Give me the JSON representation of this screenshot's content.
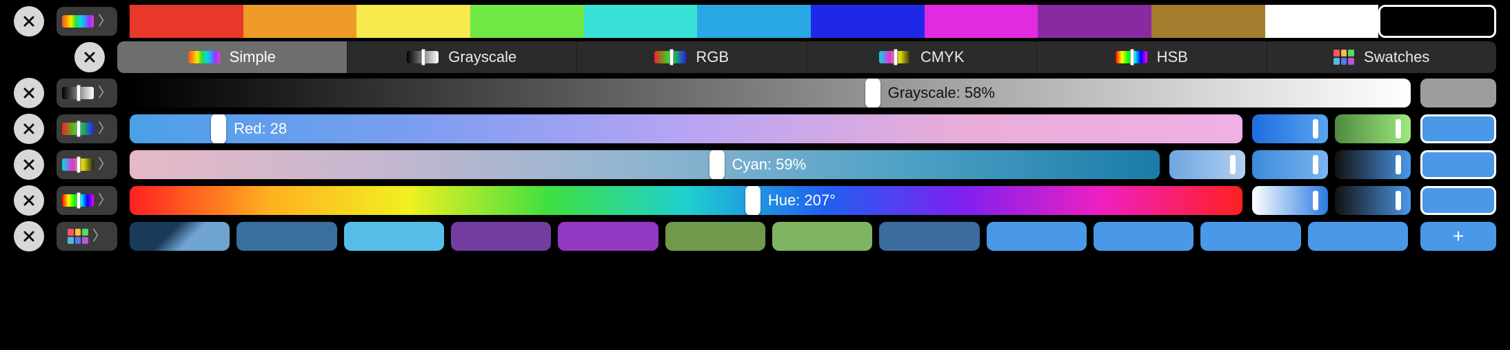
{
  "simple": {
    "colors": [
      "#e8382b",
      "#ef9b27",
      "#f8e94c",
      "#6fe845",
      "#38e2d6",
      "#2aa7e5",
      "#2028e7",
      "#e22be0",
      "#8a2aa0",
      "#a47c2d",
      "#ffffff",
      "#000000"
    ],
    "selected_index": 11
  },
  "tabs": [
    {
      "id": "simple",
      "label": "Simple"
    },
    {
      "id": "grayscale",
      "label": "Grayscale"
    },
    {
      "id": "rgb",
      "label": "RGB"
    },
    {
      "id": "cmyk",
      "label": "CMYK"
    },
    {
      "id": "hsb",
      "label": "HSB"
    },
    {
      "id": "swatches",
      "label": "Swatches"
    }
  ],
  "active_tab": "simple",
  "grayscale": {
    "label": "Grayscale: 58%",
    "percent": 58,
    "preview": "#9d9d9d"
  },
  "rgb": {
    "label": "Red: 28",
    "percent": 8,
    "preview": "#4a98e8",
    "main_gradient": "linear-gradient(90deg,#4aa0e8,#7b9df0,#b7a4f3,#e9add9,#efb0e6)",
    "mini": [
      {
        "g": "linear-gradient(90deg,#1f6de0,#5aa4f0)"
      },
      {
        "g": "linear-gradient(90deg,#4f8a3f,#9fe87e)"
      }
    ]
  },
  "cmyk": {
    "label": "Cyan: 59%",
    "percent": 57,
    "preview": "#4a98e8",
    "main_gradient": "linear-gradient(90deg,#e7b9c7,#c3b7cf,#8fb5d0,#4fa2c6,#1a7ca8)",
    "mini": [
      {
        "g": "linear-gradient(90deg,#6fa6e0,#b0cff0)"
      },
      {
        "g": "linear-gradient(90deg,#3a8bdc,#7cb4ee)"
      },
      {
        "g": "linear-gradient(90deg,#111,#4a98e8)"
      }
    ]
  },
  "hsb": {
    "label": "Hue: 207°",
    "percent": 56,
    "preview": "#4a98e8",
    "main_gradient": "linear-gradient(90deg,#ff2020,#ffb020,#f2f020,#40e040,#20d0d0,#2060f0,#8020f0,#f020c0,#ff2020)",
    "mini": [
      {
        "g": "linear-gradient(90deg,#fff,#2a7be0)"
      },
      {
        "g": "linear-gradient(90deg,#111,#4a98e8)"
      }
    ]
  },
  "swatches": {
    "colors": [
      "#3a6e9e",
      "#56bde9",
      "#733ca0",
      "#9338c2",
      "#6f9a4a",
      "#7fb560",
      "#3a6ca0",
      "#4a98e8",
      "#4a98e8",
      "#4a98e8",
      "#4a98e8"
    ],
    "first_gradient": "linear-gradient(135deg,#1a3a5a 40%,#6fa3d0 60%)",
    "add_label": "+"
  }
}
